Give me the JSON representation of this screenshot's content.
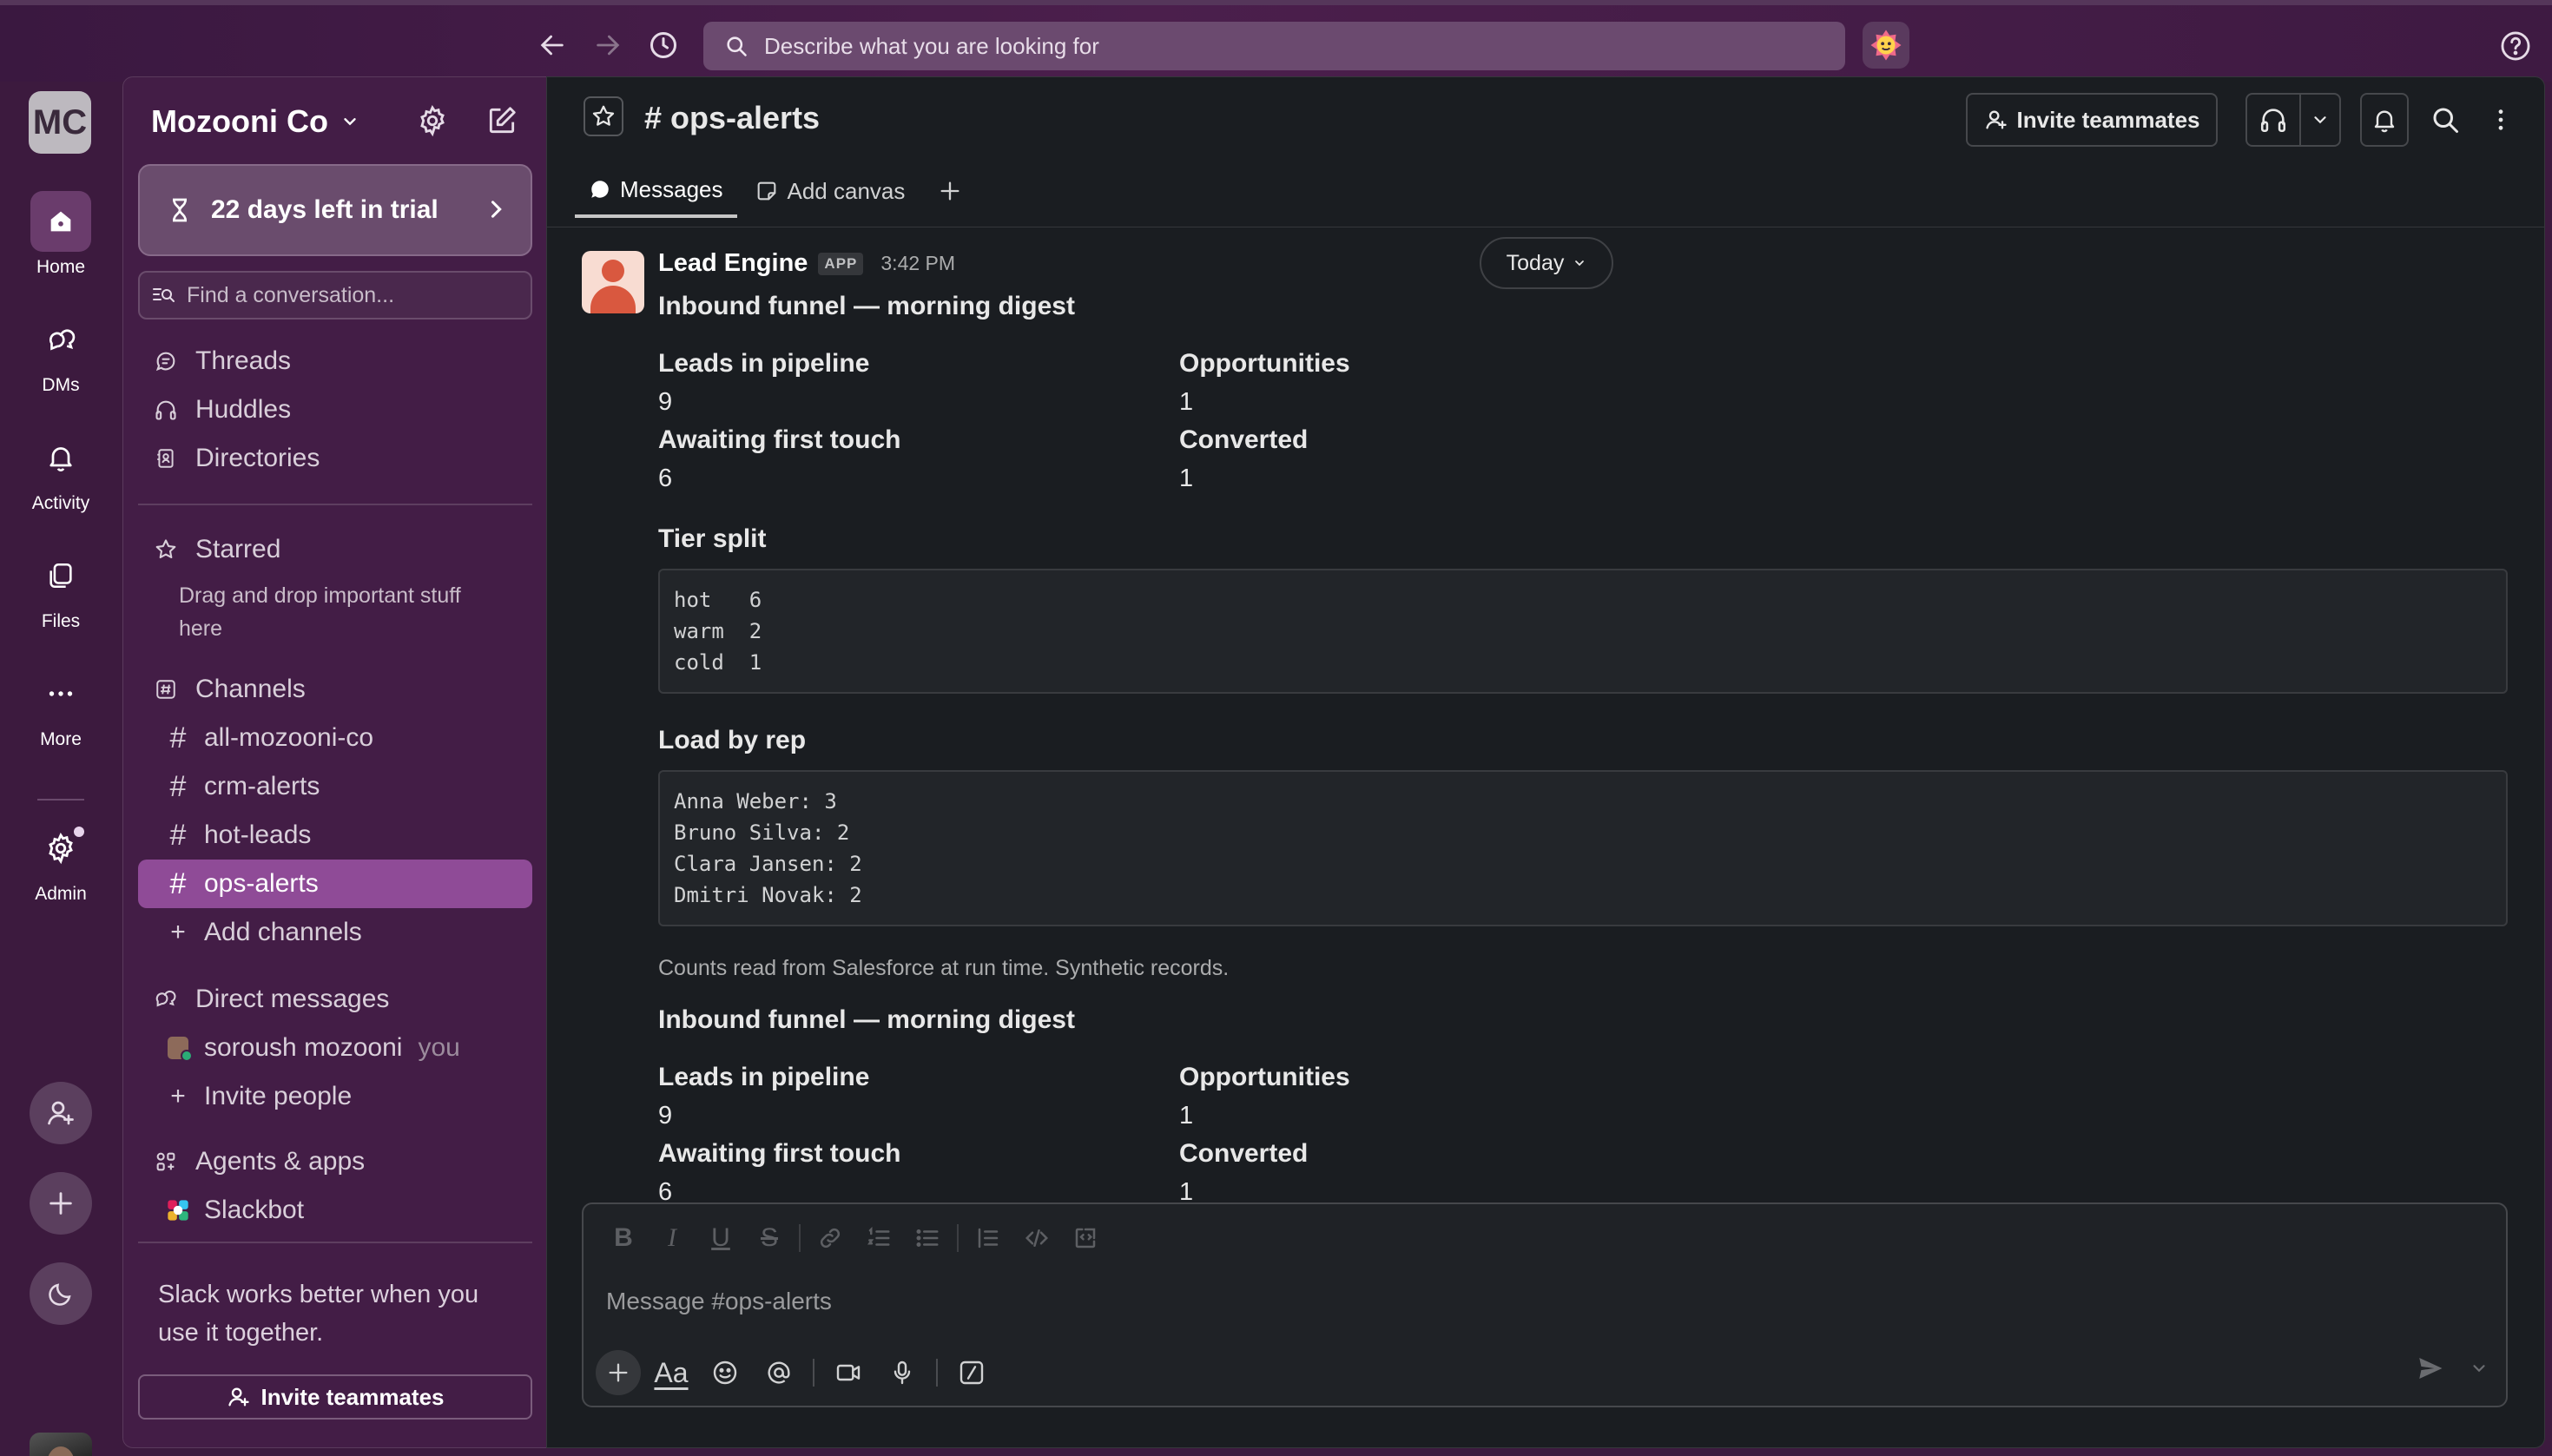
{
  "topbar": {
    "search_placeholder": "Describe what you are looking for"
  },
  "rail": {
    "workspace_initials": "MC",
    "items": [
      {
        "label": "Home"
      },
      {
        "label": "DMs"
      },
      {
        "label": "Activity"
      },
      {
        "label": "Files"
      },
      {
        "label": "More"
      },
      {
        "label": "Admin"
      }
    ]
  },
  "sidebar": {
    "workspace_name": "Mozooni Co",
    "trial_label": "22 days left in trial",
    "find_placeholder": "Find a conversation...",
    "nav": [
      "Threads",
      "Huddles",
      "Directories"
    ],
    "starred_label": "Starred",
    "starred_hint": "Drag and drop important stuff here",
    "channels_label": "Channels",
    "channels": [
      "all-mozooni-co",
      "crm-alerts",
      "hot-leads",
      "ops-alerts"
    ],
    "active_channel": "ops-alerts",
    "add_channels": "Add channels",
    "dms_label": "Direct messages",
    "dm_user": "soroush mozooni",
    "dm_you": "you",
    "invite_people": "Invite people",
    "agents_label": "Agents & apps",
    "slackbot": "Slackbot",
    "footer_text": "Slack works better when you use it together.",
    "footer_invite": "Invite teammates"
  },
  "channel": {
    "name": "# ops-alerts",
    "invite_label": "Invite teammates",
    "tabs": {
      "messages": "Messages",
      "canvas": "Add canvas"
    }
  },
  "message": {
    "sender": "Lead Engine",
    "badge": "APP",
    "time": "3:42 PM",
    "day_divider": "Today",
    "digests": [
      {
        "title": "Inbound funnel — morning digest",
        "fields": [
          {
            "label": "Leads in pipeline",
            "value": "9"
          },
          {
            "label": "Opportunities",
            "value": "1"
          },
          {
            "label": "Awaiting first touch",
            "value": "6"
          },
          {
            "label": "Converted",
            "value": "1"
          }
        ],
        "tier_title": "Tier split",
        "tier_block": "hot   6\nwarm  2\ncold  1",
        "load_title": "Load by rep",
        "load_block": "Anna Weber: 3\nBruno Silva: 2\nClara Jansen: 2\nDmitri Novak: 2",
        "note": "Counts read from Salesforce at run time. Synthetic records."
      },
      {
        "title": "Inbound funnel — morning digest",
        "fields": [
          {
            "label": "Leads in pipeline",
            "value": "9"
          },
          {
            "label": "Opportunities",
            "value": "1"
          },
          {
            "label": "Awaiting first touch",
            "value": "6"
          },
          {
            "label": "Converted",
            "value": "1"
          }
        ]
      }
    ]
  },
  "composer": {
    "placeholder": "Message #ops-alerts",
    "format_buttons": [
      "bold",
      "italic",
      "underline",
      "strikethrough",
      "link",
      "ordered-list",
      "bulleted-list",
      "blockquote",
      "code",
      "code-block"
    ]
  },
  "colors": {
    "aubergine": "#3c1a3e",
    "sidebar": "#431d46",
    "active_channel": "#8f4b97",
    "main_bg": "#1a1d21",
    "presence_green": "#2bac76"
  }
}
